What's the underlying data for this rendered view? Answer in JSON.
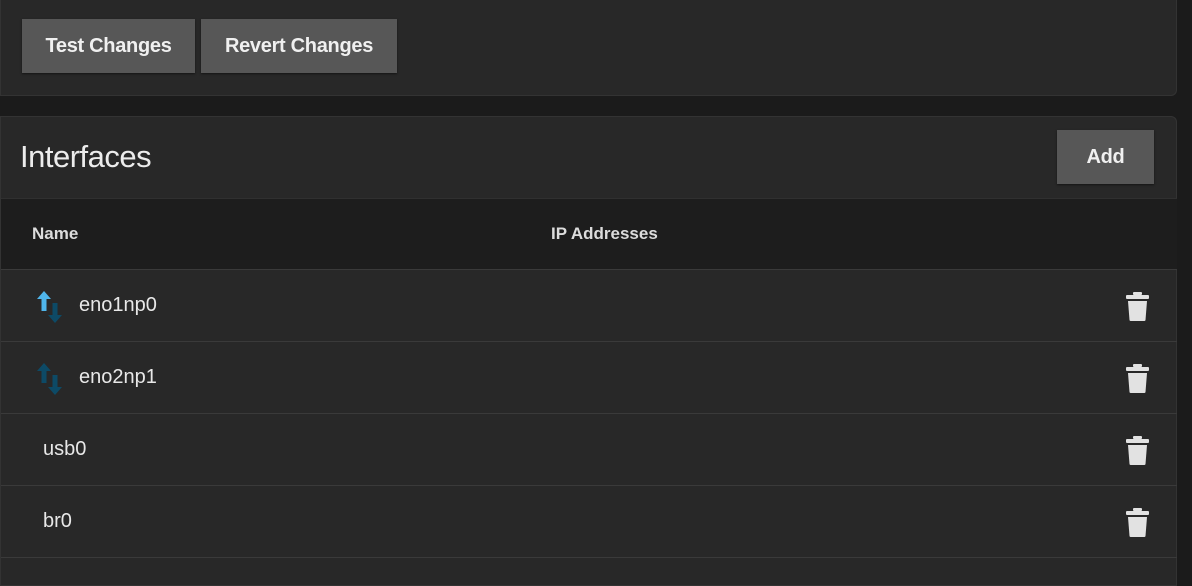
{
  "toolbar": {
    "test_label": "Test Changes",
    "revert_label": "Revert Changes"
  },
  "interfaces": {
    "title": "Interfaces",
    "add_label": "Add",
    "columns": {
      "name": "Name",
      "ip": "IP Addresses"
    },
    "rows": [
      {
        "name": "eno1np0",
        "ip": "",
        "link_icon": "link-up-icon",
        "link_state": "up"
      },
      {
        "name": "eno2np1",
        "ip": "",
        "link_icon": "link-down-icon",
        "link_state": "down"
      },
      {
        "name": "usb0",
        "ip": ""
      },
      {
        "name": "br0",
        "ip": ""
      }
    ]
  },
  "colors": {
    "background": "#1b1b1b",
    "card": "#282828",
    "button": "#575757",
    "link_up_arrow": "#4fb6ec",
    "link_arrow_dim": "#0d4a66",
    "trash_icon": "#e2e2e2"
  }
}
